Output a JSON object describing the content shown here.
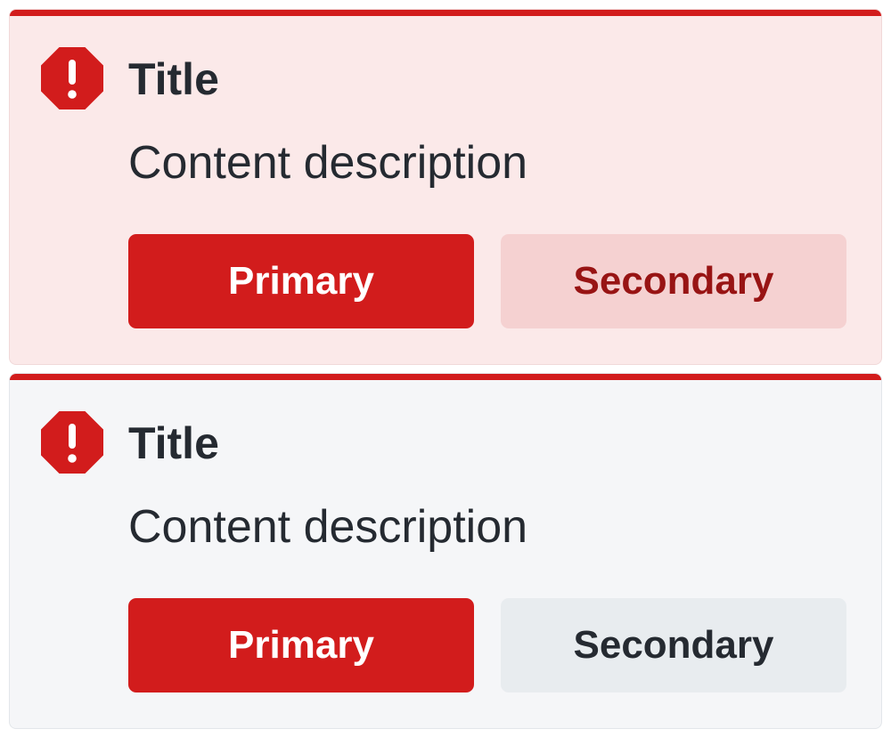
{
  "colors": {
    "critical": "#d21c1c",
    "critical_subtle_bg": "#fbe9e9",
    "secondary_critical_bg": "#f5d1d1",
    "secondary_critical_text": "#981414",
    "neutral_bg": "#f5f6f8",
    "secondary_neutral_bg": "#e8ecef",
    "secondary_neutral_text": "#252a31"
  },
  "alerts": [
    {
      "variant": "tinted",
      "icon": "alert-octagon-icon",
      "title": "Title",
      "description": "Content description",
      "primary_label": "Primary",
      "secondary_label": "Secondary"
    },
    {
      "variant": "neutral",
      "icon": "alert-octagon-icon",
      "title": "Title",
      "description": "Content description",
      "primary_label": "Primary",
      "secondary_label": "Secondary"
    }
  ]
}
